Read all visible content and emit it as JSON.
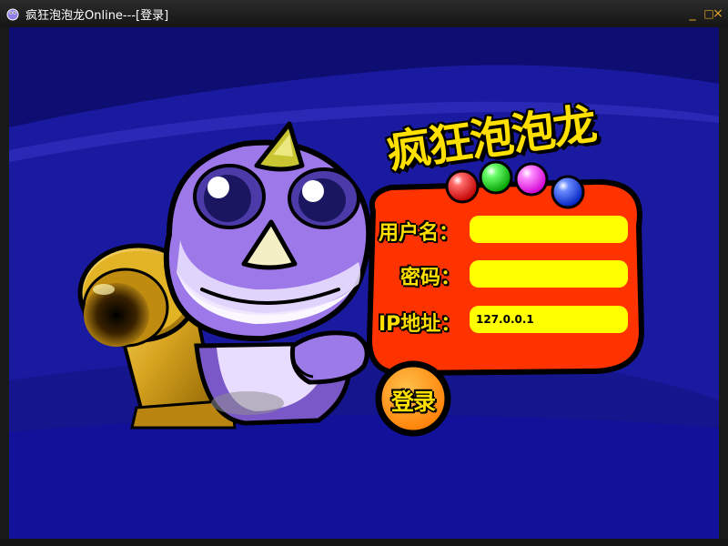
{
  "window": {
    "title": "疯狂泡泡龙Online---[登录]",
    "minimize_glyph": "_",
    "maximize_glyph": "□",
    "close_glyph": "×"
  },
  "game": {
    "title": "疯狂泡泡龙"
  },
  "login": {
    "username_label": "用户名：",
    "password_label": "密码：",
    "ip_label": "IP地址：",
    "username_value": "",
    "password_value": "",
    "ip_value": "127.0.0.1",
    "button_label": "登录"
  },
  "colors": {
    "background": "#1a1aa0",
    "panel": "#ff3300",
    "field": "#ffff00",
    "label": "#ffe000",
    "button": "#ff9900",
    "dragon": "#9d78e8"
  },
  "icons": {
    "app": "dragon-app-icon",
    "cannon": "cannon",
    "bubbles": [
      "red-bubble",
      "green-bubble",
      "pink-bubble",
      "blue-bubble"
    ]
  }
}
